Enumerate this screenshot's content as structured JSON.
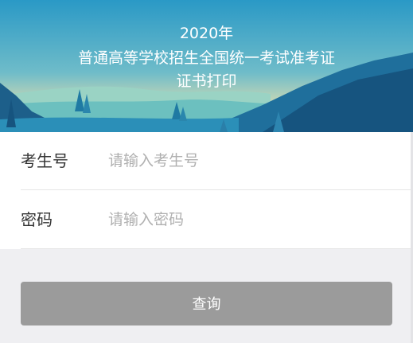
{
  "banner": {
    "line1": "2020年",
    "line2": "普通高等学校招生全国统一考试准考证",
    "line3": "证书打印"
  },
  "form": {
    "exam_id_label": "考生号",
    "exam_id_placeholder": "请输入考生号",
    "exam_id_value": "",
    "password_label": "密码",
    "password_placeholder": "请输入密码",
    "password_value": ""
  },
  "actions": {
    "query_label": "查询"
  },
  "colors": {
    "sky_top": "#2d9cc7",
    "button_bg": "#9b9b9b",
    "page_bg": "#efeff2"
  }
}
